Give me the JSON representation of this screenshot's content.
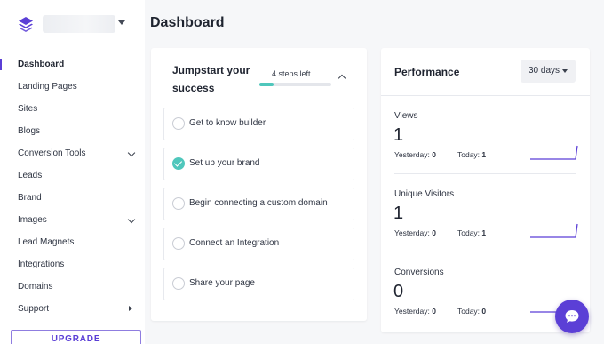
{
  "sidebar": {
    "items": [
      {
        "label": "Dashboard",
        "active": true,
        "icon": ""
      },
      {
        "label": "Landing Pages",
        "icon": ""
      },
      {
        "label": "Sites",
        "icon": ""
      },
      {
        "label": "Blogs",
        "icon": ""
      },
      {
        "label": "Conversion Tools",
        "icon": "chevron-down-icon"
      },
      {
        "label": "Leads",
        "icon": ""
      },
      {
        "label": "Brand",
        "icon": ""
      },
      {
        "label": "Images",
        "icon": "chevron-down-icon"
      },
      {
        "label": "Lead Magnets",
        "icon": ""
      },
      {
        "label": "Integrations",
        "icon": ""
      },
      {
        "label": "Domains",
        "icon": ""
      },
      {
        "label": "Support",
        "icon": "caret-right-icon"
      }
    ],
    "upgrade_label": "UPGRADE"
  },
  "header": {
    "title": "Dashboard"
  },
  "jumpstart": {
    "title": "Jumpstart your success",
    "steps_left": "4 steps left",
    "progress": 0.2,
    "tasks": [
      {
        "label": "Get to know builder",
        "done": false
      },
      {
        "label": "Set up your brand",
        "done": true
      },
      {
        "label": "Begin connecting a custom domain",
        "done": false
      },
      {
        "label": "Connect an Integration",
        "done": false
      },
      {
        "label": "Share your page",
        "done": false
      }
    ]
  },
  "performance": {
    "title": "Performance",
    "range": "30 days",
    "metrics": [
      {
        "label": "Views",
        "value": "1",
        "yesterday_label": "Yesterday:",
        "yesterday": "0",
        "today_label": "Today:",
        "today": "1"
      },
      {
        "label": "Unique Visitors",
        "value": "1",
        "yesterday_label": "Yesterday:",
        "yesterday": "0",
        "today_label": "Today:",
        "today": "1"
      },
      {
        "label": "Conversions",
        "value": "0",
        "yesterday_label": "Yesterday:",
        "yesterday": "0",
        "today_label": "Today:",
        "today": "0"
      }
    ]
  },
  "colors": {
    "accent": "#5b3fd6",
    "teal": "#4fc7bc"
  }
}
